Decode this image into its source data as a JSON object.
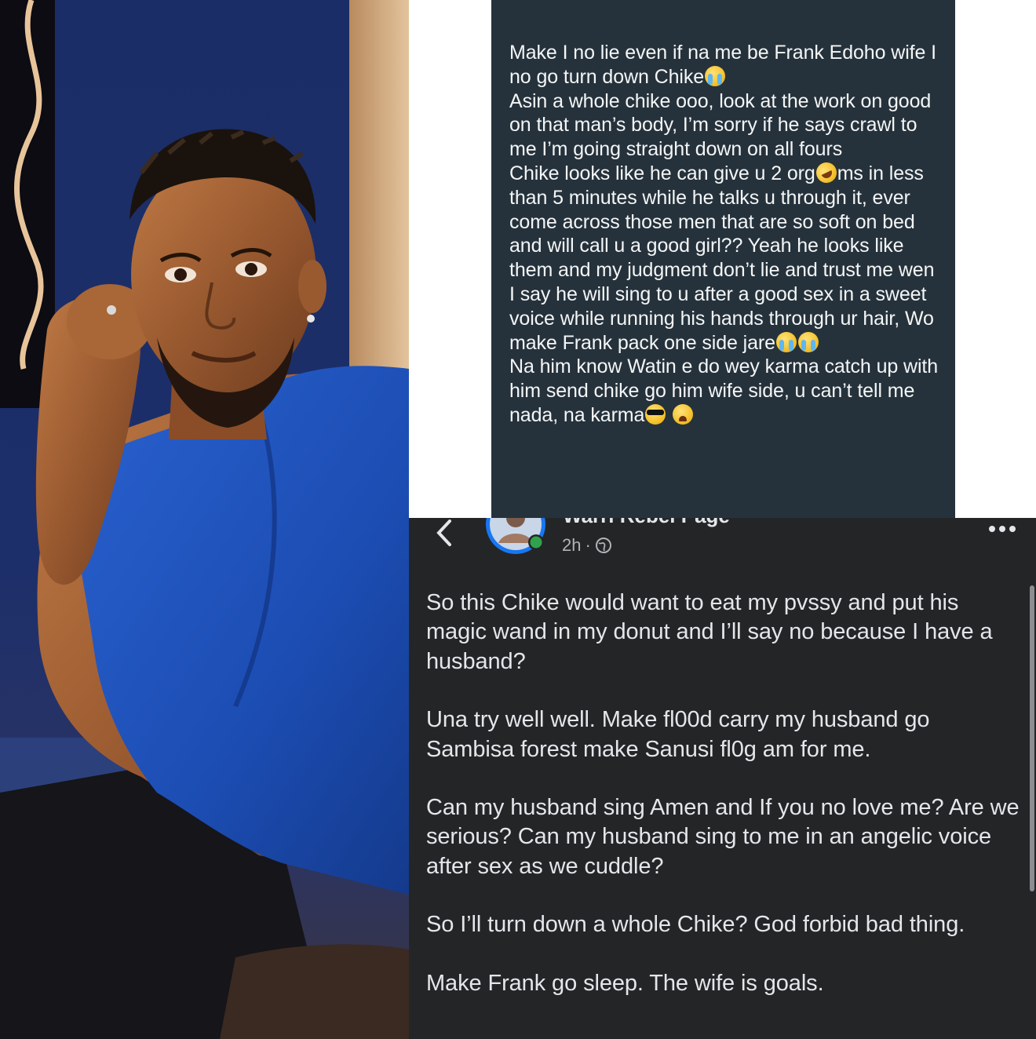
{
  "note": {
    "paragraphs": [
      {
        "text": "Make I no lie even if na me be Frank Edoho wife I no go turn down Chike",
        "emoji_after": [
          "loudly-crying-face"
        ]
      },
      {
        "text": "Asin a whole chike ooo, look at the work on good on that man’s body, I’m sorry if he says crawl to me I’m going straight down on all fours",
        "emoji_after": []
      },
      {
        "text_before": "Chike looks like he can give u 2 org",
        "emoji_mid": "rolling-on-floor-laughing-face",
        "text": "ms in less than 5 minutes while he talks u through it, ever come across those men that are so soft on bed and will call u a good girl?? Yeah he looks like them and my judgment don’t lie and trust me wen I say he will sing to u after a good sex in a sweet voice while running his hands through ur hair, Wo make Frank pack one side jare",
        "emoji_after": [
          "loudly-crying-face",
          "loudly-crying-face"
        ]
      },
      {
        "text": "Na him know Watin e do wey karma catch up with him send chike go him wife side, u can’t tell me nada, na karma",
        "emoji_after": [
          "smiling-face-with-sunglasses",
          "weary-face"
        ]
      }
    ],
    "background": "#26323b"
  },
  "post": {
    "page_name": "Warri Rebel Page",
    "time": "2h",
    "separator": "·",
    "audience_icon": "globe-icon",
    "paragraphs": [
      "So this Chike would want to eat my pvssy and put his magic wand in my donut and I’ll say no because I have a husband?",
      "Una try well well. Make fl00d carry my husband go Sambisa forest make Sanusi fl0g am for me.",
      "Can my husband sing Amen and If you no love me? Are we serious? Can my husband sing to me in an angelic voice after sex as we cuddle?",
      "So I’ll turn down a whole Chike? God forbid bad thing.",
      "Make Frank go sleep. The wife is goals."
    ],
    "background": "#242526",
    "online_status_color": "#31a24c"
  },
  "photo": {
    "subject": "man-in-blue-vest-portrait",
    "vest_color": "#1f4fb0",
    "backdrop_color": "#1c2f6a"
  }
}
